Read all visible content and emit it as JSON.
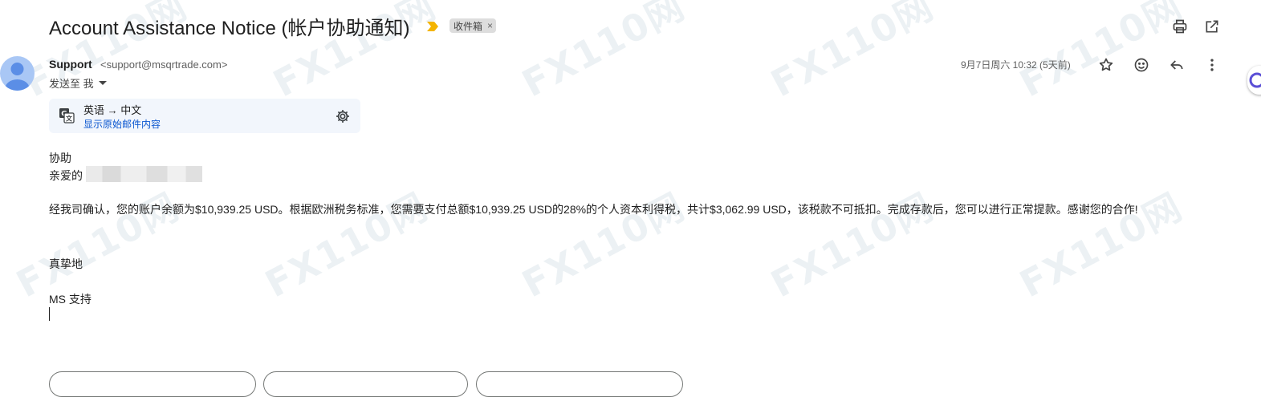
{
  "email": {
    "subject": "Account Assistance Notice (帐户协助通知)",
    "label": "收件箱",
    "label_remove": "×",
    "sender_name": "Support",
    "sender_email": "<support@msqrtrade.com>",
    "to_line": "发送至 我",
    "date": "9月7日周六 10:32 (5天前)"
  },
  "translate": {
    "languages": "英语 → 中文",
    "show_original": "显示原始邮件内容"
  },
  "body": {
    "line1": "协助",
    "greeting": "亲爱的",
    "paragraph": "经我司确认，您的账户余额为$10,939.25 USD。根据欧洲税务标准，您需要支付总额$10,939.25 USD的28%的个人资本利得税，共计$3,062.99 USD，该税款不可抵扣。完成存款后，您可以进行正常提款。感谢您的合作!",
    "closing": "真挚地",
    "signature": "MS 支持"
  },
  "watermark": "FX110网",
  "colors": {
    "link": "#0b57d0",
    "importance": "#f4b400",
    "translate_bg": "#f2f6fc",
    "avatar_bg": "#a9c7f5"
  }
}
